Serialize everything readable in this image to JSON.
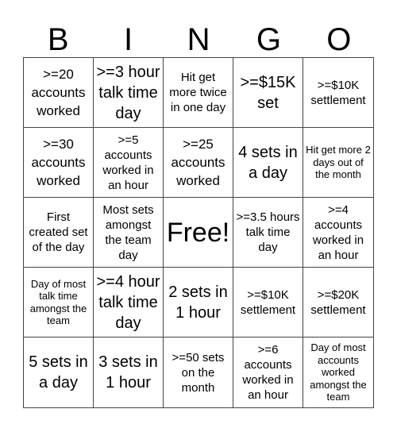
{
  "header": {
    "letters": [
      "B",
      "I",
      "N",
      "G",
      "O"
    ]
  },
  "cells": [
    ">=20 accounts worked",
    ">=3 hour talk time day",
    "Hit get more twice in one day",
    ">=$15K set",
    ">=$10K settlement",
    ">=30 accounts worked",
    ">=5 accounts worked in an hour",
    ">=25 accounts worked",
    "4 sets in a day",
    "Hit get more 2 days out of the month",
    "First created set of the day",
    "Most sets amongst the team day",
    "Free!",
    ">=3.5 hours talk time day",
    ">=4 accounts worked in an hour",
    "Day of most talk time amongst the team",
    ">=4 hour talk time day",
    "2 sets in 1 hour",
    ">=$10K settlement",
    ">=$20K settlement",
    "5 sets in a day",
    "3 sets in 1 hour",
    ">=50 sets on the month",
    ">=6 accounts worked in an hour",
    "Day of most accounts worked amongst the team"
  ]
}
